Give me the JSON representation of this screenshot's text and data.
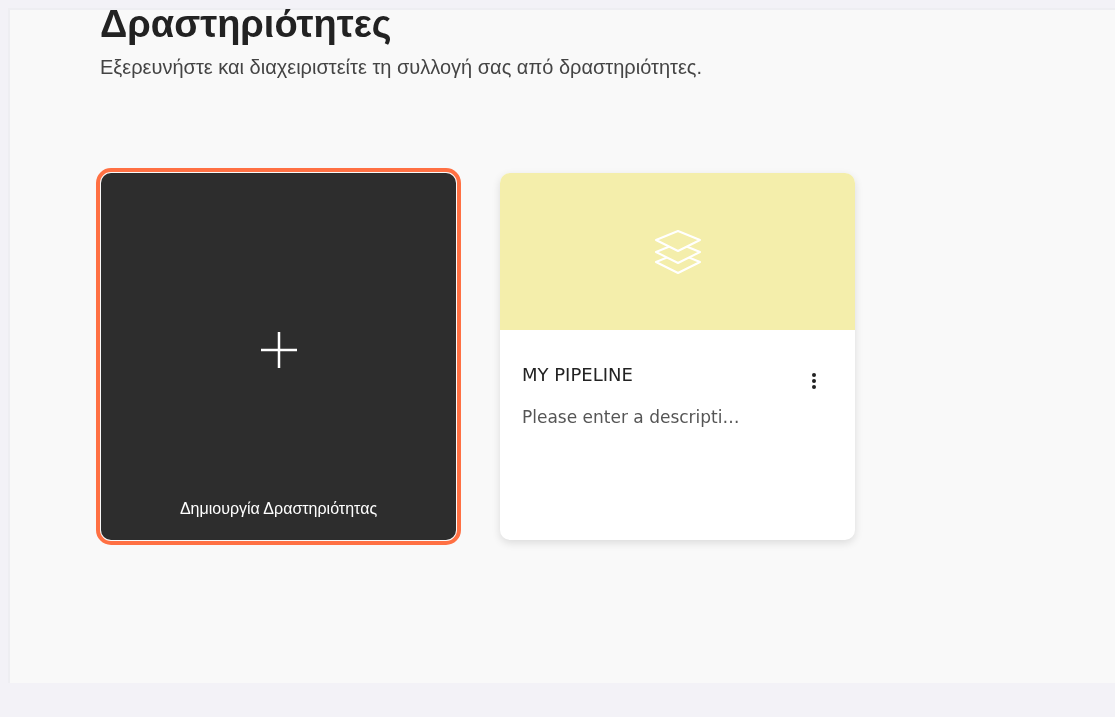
{
  "header": {
    "title": "Δραστηριότητες",
    "subtitle": "Εξερευνήστε και διαχειριστείτε τη συλλογή σας από δραστηριότητες."
  },
  "cards": [
    {
      "kind": "create",
      "label": "Δημιουργία Δραστηριότητας",
      "selected": true
    },
    {
      "kind": "activity",
      "title": "MY PIPELINE",
      "description": "Please enter a descripti…",
      "color": "#f4eeab",
      "selected": false
    }
  ]
}
